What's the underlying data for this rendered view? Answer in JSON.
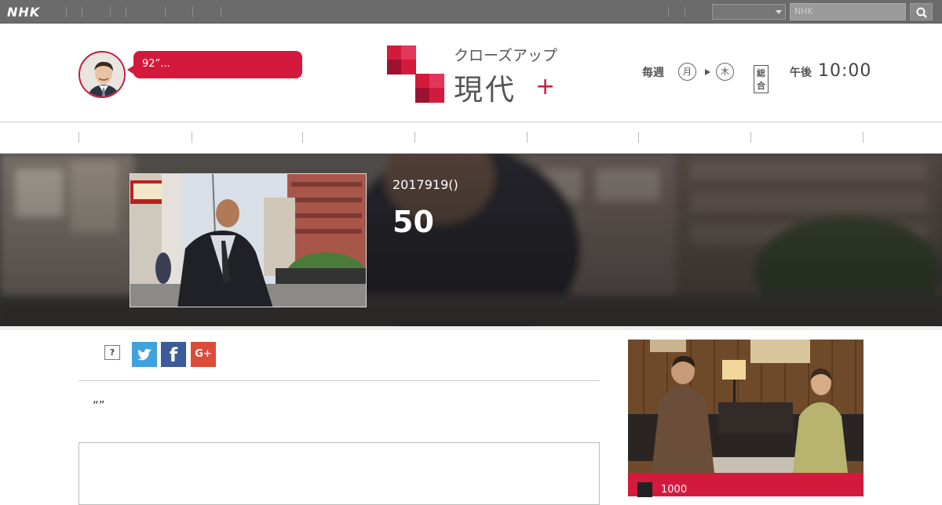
{
  "topbar": {
    "brand": "NHK",
    "search_placeholder": "NHK",
    "icons": {
      "search": "search-icon"
    }
  },
  "header": {
    "speech_text": "92”...",
    "logo_kana": "クローズアップ",
    "logo_kanji": "現代",
    "logo_plus": "+",
    "schedule": {
      "weekly": "毎週",
      "day_from": "月",
      "day_to": "木",
      "channel": "総合",
      "pm": "午後",
      "time": "10:00"
    }
  },
  "hero": {
    "date": "2017919()",
    "title": "50"
  },
  "main": {
    "help_label": "?",
    "share": {
      "twitter": "twitter-icon",
      "facebook_glyph": "f",
      "googleplus_glyph": "G+"
    },
    "quote_text": "“”"
  },
  "side": {
    "count": "1000"
  },
  "colors": {
    "accent": "#d41a3c",
    "topbar": "#6b6b6b",
    "twitter": "#3fa2dd",
    "facebook": "#3d5b99",
    "googleplus": "#dd4b39"
  }
}
